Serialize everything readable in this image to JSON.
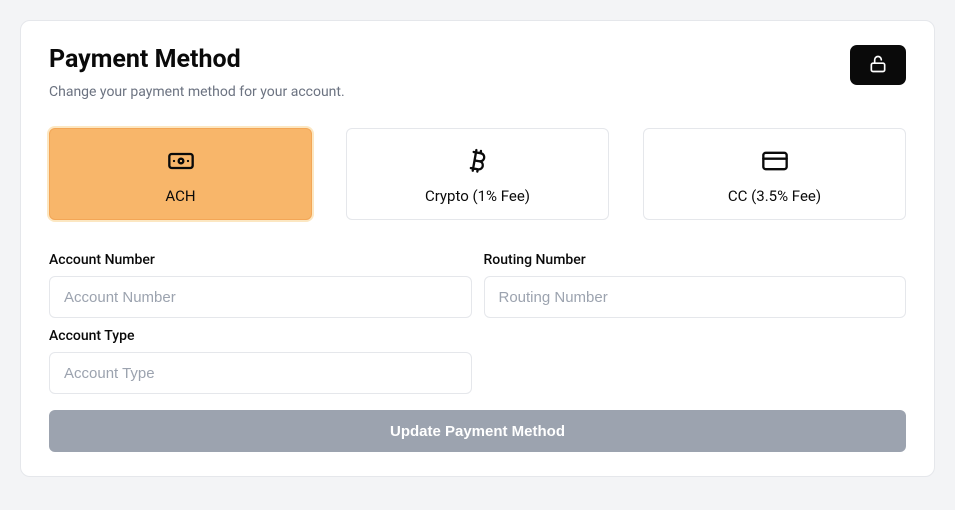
{
  "header": {
    "title": "Payment Method",
    "subtitle": "Change your payment method for your account."
  },
  "methods": {
    "ach": {
      "label": "ACH"
    },
    "crypto": {
      "label": "Crypto (1% Fee)"
    },
    "cc": {
      "label": "CC (3.5% Fee)"
    }
  },
  "fields": {
    "account_number": {
      "label": "Account Number",
      "placeholder": "Account Number",
      "value": ""
    },
    "routing_number": {
      "label": "Routing Number",
      "placeholder": "Routing Number",
      "value": ""
    },
    "account_type": {
      "label": "Account Type",
      "placeholder": "Account Type",
      "value": ""
    }
  },
  "submit": {
    "label": "Update Payment Method"
  }
}
